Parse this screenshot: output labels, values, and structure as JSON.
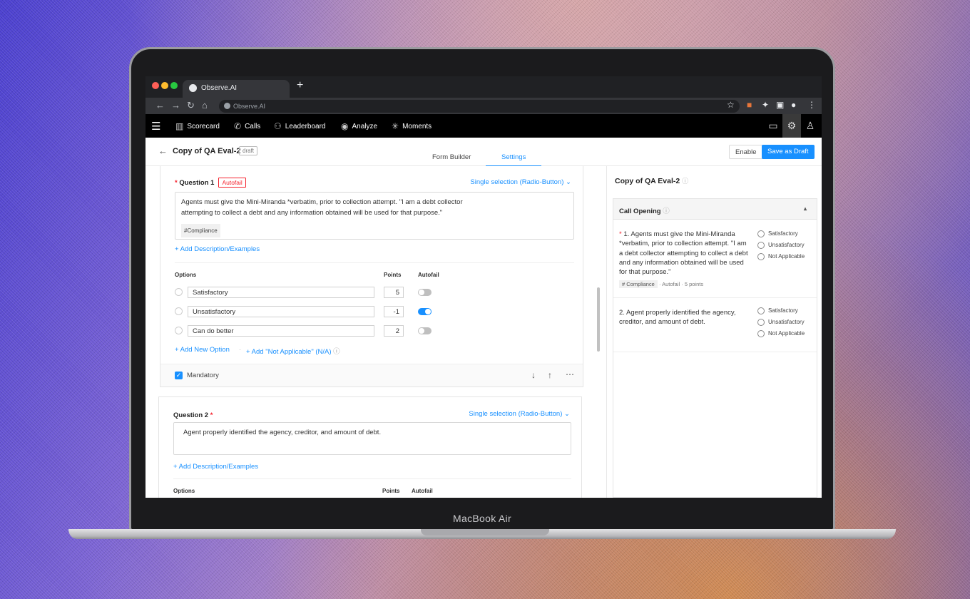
{
  "browser": {
    "tab_title": "Observe.AI",
    "url": "Observe.AI"
  },
  "device": {
    "brand": "MacBook Air"
  },
  "nav": {
    "items": [
      "Scorecard",
      "Calls",
      "Leaderboard",
      "Analyze",
      "Moments"
    ]
  },
  "header": {
    "title": "Copy of QA Eval-2",
    "badge": "draft",
    "tabs": [
      "Form Builder",
      "Settings"
    ],
    "active_tab": "Settings",
    "enable": "Enable",
    "save": "Save as Draft"
  },
  "q1": {
    "label": "Question 1",
    "autofail": "Autofail",
    "type": "Single selection (Radio-Button)",
    "text": "Agents must give the Mini-Miranda *verbatim, prior to collection attempt. \"I am a debt collector attempting to collect a debt and any information obtained will be used for that purpose.\"",
    "tag": "#Compliance",
    "add_desc": "Add Description/Examples",
    "col_options": "Options",
    "col_points": "Points",
    "col_autofail": "Autofail",
    "options": [
      {
        "label": "Satisfactory",
        "points": "5",
        "autofail": false
      },
      {
        "label": "Unsatisfactory",
        "points": "-1",
        "autofail": true
      },
      {
        "label": "Can do better",
        "points": "2",
        "autofail": false
      }
    ],
    "add_option": "Add New Option",
    "add_na": "Add \"Not Applicable\" (N/A)",
    "mandatory": "Mandatory"
  },
  "q2": {
    "label": "Question 2",
    "type": "Single selection (Radio-Button)",
    "text": "Agent properly identified the agency, creditor, and amount of debt.",
    "add_desc": "Add Description/Examples",
    "col_options": "Options",
    "col_points": "Points",
    "col_autofail": "Autofail"
  },
  "preview": {
    "title": "Copy of QA Eval-2",
    "section": "Call Opening",
    "q1": "1. Agents must give the Mini-Miranda *verbatim, prior to collection attempt. \"I am a debt collector attempting to collect a debt and any information obtained will be used for that purpose.\"",
    "q1_tag": "# Compliance",
    "q1_autofail": "Autofail",
    "q1_points": "5 points",
    "q2": "2. Agent properly identified the agency, creditor, and amount of debt.",
    "answers": [
      "Satisfactory",
      "Unsatisfactory",
      "Not Applicable"
    ]
  },
  "colors": {
    "accent": "#1890ff",
    "danger": "#f5222d"
  }
}
